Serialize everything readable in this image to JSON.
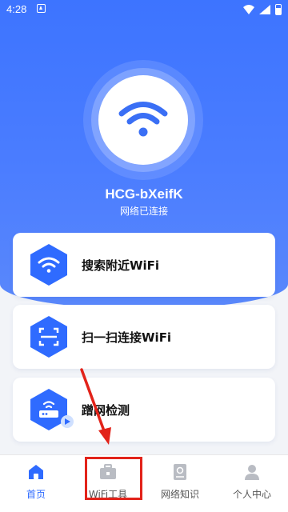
{
  "status_bar": {
    "time": "4:28",
    "icons": [
      "notification-icon",
      "wifi-signal-icon",
      "cell-signal-icon",
      "battery-icon"
    ]
  },
  "hero": {
    "ssid": "HCG-bXeifK",
    "status": "网络已连接",
    "icon": "wifi-icon"
  },
  "cards": [
    {
      "label": "搜索附近WiFi",
      "icon": "wifi-icon"
    },
    {
      "label": "扫一扫连接WiFi",
      "icon": "scan-icon"
    },
    {
      "label": "蹭网检测",
      "icon": "router-icon"
    }
  ],
  "tabs": [
    {
      "label": "首页",
      "icon": "home-icon",
      "active": true
    },
    {
      "label": "WiFi工具",
      "icon": "toolbox-icon",
      "active": false
    },
    {
      "label": "网络知识",
      "icon": "book-icon",
      "active": false
    },
    {
      "label": "个人中心",
      "icon": "person-icon",
      "active": false
    }
  ],
  "colors": {
    "primary": "#3d74ff",
    "active_tab": "#2f6bff",
    "annotation": "#e2231a"
  }
}
